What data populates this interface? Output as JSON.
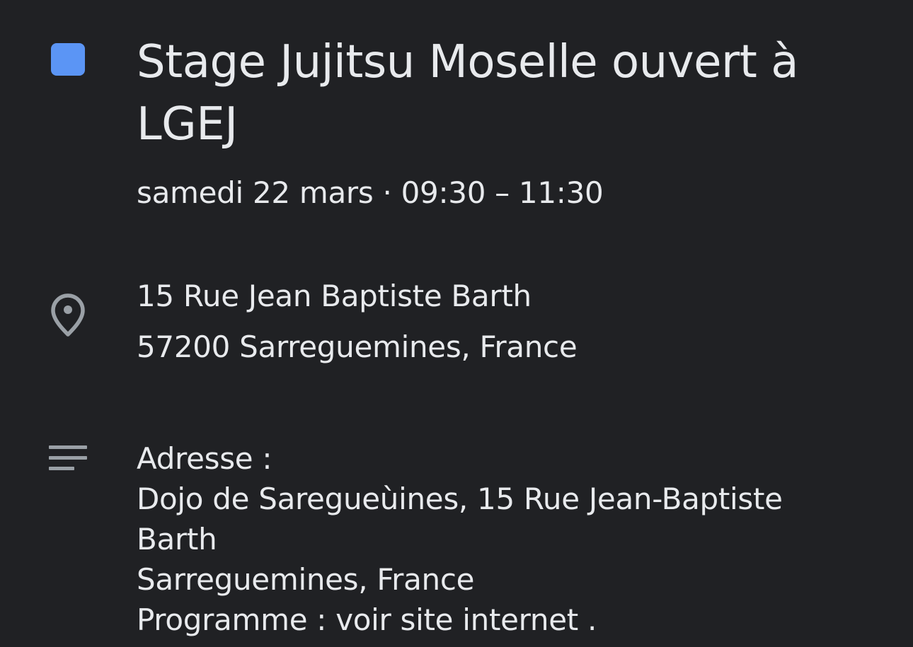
{
  "event": {
    "calendar_color": "#5b95f5",
    "title": "Stage Jujitsu Moselle ouvert à LGEJ",
    "datetime": "samedi 22 mars · 09:30 – 11:30"
  },
  "location": {
    "icon": "map-pin-icon",
    "line1": "15 Rue Jean Baptiste Barth",
    "line2": "57200 Sarreguemines, France"
  },
  "description": {
    "icon": "notes-icon",
    "lines": [
      "Adresse :",
      "Dojo de Saregueùines, 15 Rue Jean-Baptiste",
      "Barth",
      "Sarreguemines, France",
      "Programme : voir site internet ."
    ]
  }
}
